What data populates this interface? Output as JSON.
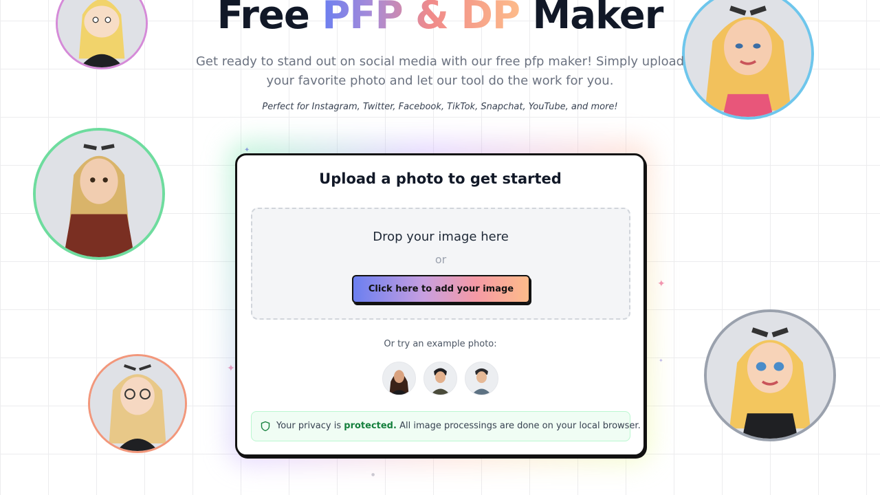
{
  "hero": {
    "title_part1": "Free",
    "title_part2": "PFP & DP",
    "title_part3": "Maker",
    "subtitle": "Get ready to stand out on social media with our free pfp maker! Simply upload your favorite photo and let our tool do the work for you.",
    "platforms": "Perfect for Instagram, Twitter, Facebook, TikTok, Snapchat, YouTube, and more!"
  },
  "upload": {
    "heading": "Upload a photo to get started",
    "drop_label": "Drop your image here",
    "or_label": "or",
    "button_label": "Click here to add your image",
    "examples_label": "Or try an example photo:"
  },
  "privacy": {
    "prefix": "Your privacy is",
    "highlight": "protected.",
    "suffix": "All image processings are done on your local browser."
  },
  "colors": {
    "ring_purple": "#d58ad8",
    "ring_blue": "#6ec6ec",
    "ring_green": "#6edc9e",
    "ring_orange": "#f2977b",
    "ring_gray": "#9aa1ad",
    "privacy_green": "#15803d",
    "gradient_start": "#6b7ff0",
    "gradient_end": "#fdbb8a"
  },
  "icons": {
    "privacy": "shield-icon",
    "sparkle": "sparkle-icon"
  }
}
